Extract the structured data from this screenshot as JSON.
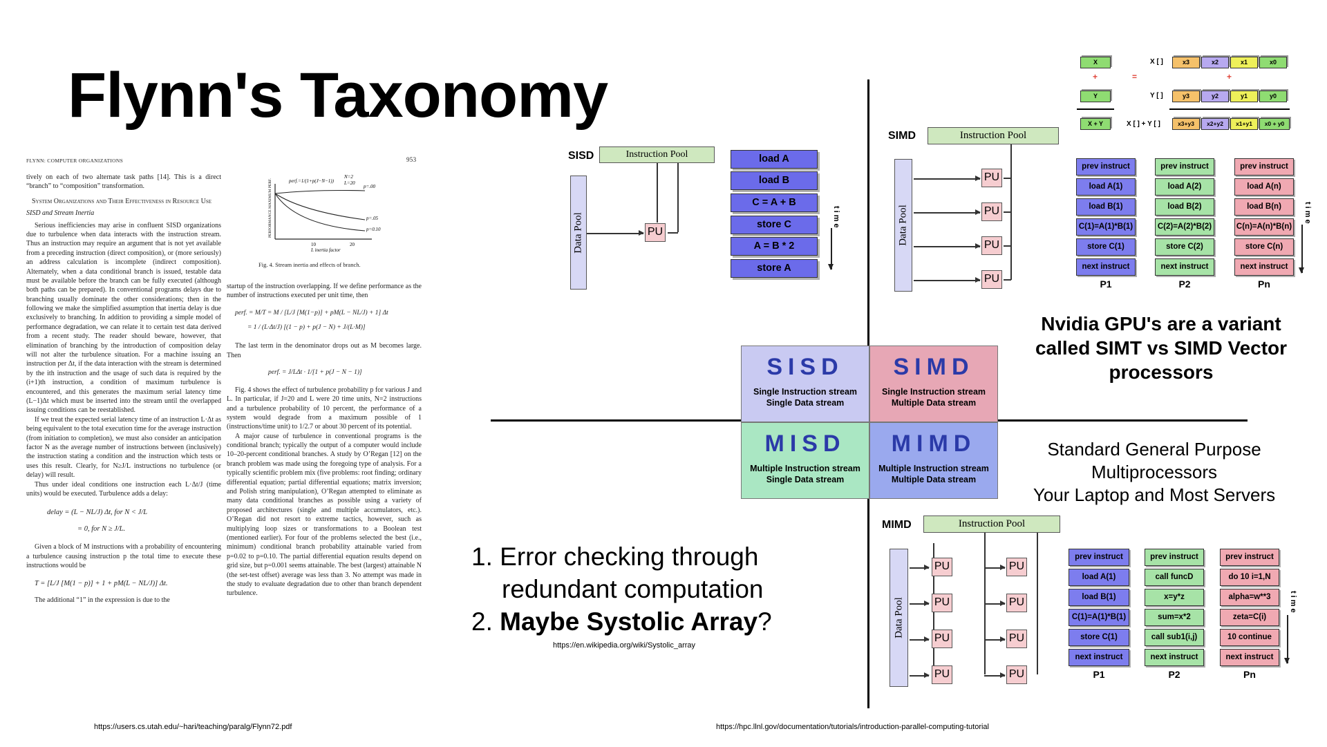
{
  "title": "Flynn's Taxonomy",
  "paper": {
    "header_left": "FLYNN: COMPUTER ORGANIZATIONS",
    "page_number": "953",
    "intro": "tively on each of two alternate task paths [14]. This is a direct “branch” to “composition” transformation.",
    "section_title": "System Organizations and Their Effectiveness in Resource Use",
    "subsection_title": "SISD and Stream Inertia",
    "para1": "Serious inefficiencies may arise in confluent SISD organizations due to turbulence when data interacts with the instruction stream. Thus an instruction may require an argument that is not yet available from a preceding instruction (direct composition), or (more seriously) an address calculation is incomplete (indirect composition). Alternately, when a data conditional branch is issued, testable data must be available before the branch can be fully executed (although both paths can be prepared). In conventional programs delays due to branching usually dominate the other considerations; then in the following we make the simplified assumption that inertia delay is due exclusively to branching. In addition to providing a simple model of performance degradation, we can relate it to certain test data derived from a recent study. The reader should beware, however, that elimination of branching by the introduction of composition delay will not alter the turbulence situation. For a machine issuing an instruction per Δt, if the data interaction with the stream is determined by the ith instruction and the usage of such data is required by the (i+1)th instruction, a condition of maximum turbulence is encountered, and this generates the maximum serial latency time (L−1)Δt which must be inserted into the stream until the overlapped issuing conditions can be reestablished.",
    "para2": "If we treat the expected serial latency time of an instruction L·Δt as being equivalent to the total execution time for the average instruction (from initiation to completion), we must also consider an anticipation factor N as the average number of instructions between (inclusively) the instruction stating a condition and the instruction which tests or uses this result. Clearly, for N≥J/L instructions no turbulence (or delay) will result.",
    "para3": "Thus under ideal conditions one instruction each L·Δt/J (time units) would be executed. Turbulence adds a delay:",
    "delay_formula_1": "delay = (L − NL/J) Δt,      for N < J/L",
    "delay_formula_2": "= 0,                        for N ≥ J/L.",
    "para4": "Given a block of M instructions with a probability of encountering a turbulence causing instruction p the total time to execute these instructions would be",
    "time_formula": "T = [L/J [M(1 − p)] + 1 + pM(L − NL/J)] Δt.",
    "para5": "The additional “1” in the expression is due to the",
    "fig_caption": "Fig. 4.   Stream inertia and effects of branch.",
    "fig_ylabel": "PERFORMANCE MAXIMUM PERF.",
    "fig_xlabel": "L inertia factor",
    "fig_curve_labels": [
      "p=.00",
      "p=.05",
      "p=0.10"
    ],
    "fig_params": [
      "N=2",
      "L=20"
    ],
    "fig_xticks": [
      "10",
      "20"
    ],
    "fig_topnote": "perf.=1/(1+p(J−N−1))",
    "col2_para1": "startup of the instruction overlapping. If we define performance as the number of instructions executed per unit time, then",
    "perf_formula_1": "perf. = M/T = M / [L/J [M(1−p)] + pM(L − NL/J) + 1] Δt",
    "perf_formula_2": "= 1 / (L·Δt/J) [(1 − p) + p(J − N) + J/(L·M)]",
    "col2_para2": "The last term in the denominator drops out as M becomes large. Then",
    "perf_formula_3": "perf. = J/LΔt · 1/[1 + p(J − N − 1)]",
    "col2_para3": "Fig. 4 shows the effect of turbulence probability p for various J and L. In particular, if J=20 and L were 20 time units, N=2 instructions and a turbulence probability of 10 percent, the performance of a system would degrade from a maximum possible of 1 (instructions/time unit) to 1/2.7 or about 30 percent of its potential.",
    "col2_para4": "A major cause of turbulence in conventional programs is the conditional branch; typically the output of a computer would include 10–20-percent conditional branches. A study by O’Regan [12] on the branch problem was made using the foregoing type of analysis. For a typically scientific problem mix (five problems: root finding; ordinary differential equation; partial differential equations; matrix inversion; and Polish string manipulation), O’Regan attempted to eliminate as many data conditional branches as possible using a variety of proposed architectures (single and multiple accumulators, etc.). O’Regan did not resort to extreme tactics, however, such as multiplying loop sizes or transformations to a Boolean test (mentioned earlier). For four of the problems selected the best (i.e., minimum) conditional branch probability attainable varied from p=0.02 to p=0.10. The partial differential equation results depend on grid size, but p=0.001 seems attainable. The best (largest) attainable N (the set-test offset) average was less than 3. No attempt was made in the study to evaluate degradation due to other than branch dependent turbulence."
  },
  "sisd": {
    "label": "SISD",
    "instruction_pool": "Instruction Pool",
    "data_pool": "Data Pool",
    "pu": "PU",
    "instructions": [
      "load A",
      "load B",
      "C = A + B",
      "store C",
      "A = B * 2",
      "store A"
    ],
    "time_label": "time"
  },
  "simd": {
    "label": "SIMD",
    "instruction_pool": "Instruction Pool",
    "data_pool": "Data Pool",
    "pu": [
      "PU",
      "PU",
      "PU",
      "PU"
    ],
    "time_label": "time",
    "columns": [
      {
        "label": "P1",
        "cells": [
          "prev instruct",
          "load A(1)",
          "load B(1)",
          "C(1)=A(1)*B(1)",
          "store C(1)",
          "next instruct"
        ]
      },
      {
        "label": "P2",
        "cells": [
          "prev instruct",
          "load A(2)",
          "load B(2)",
          "C(2)=A(2)*B(2)",
          "store C(2)",
          "next instruct"
        ]
      },
      {
        "label": "Pn",
        "cells": [
          "prev instruct",
          "load A(n)",
          "load B(n)",
          "C(n)=A(n)*B(n)",
          "store C(n)",
          "next instruct"
        ]
      }
    ]
  },
  "vector_add": {
    "row_x": {
      "short": "X",
      "label": "X [ ]",
      "cells": [
        "x3",
        "x2",
        "x1",
        "x0"
      ]
    },
    "row_y": {
      "short": "Y",
      "label": "Y [ ]",
      "cells": [
        "y3",
        "y2",
        "y1",
        "y0"
      ]
    },
    "row_sum": {
      "short": "X + Y",
      "label": "X [ ] + Y [ ]",
      "cells": [
        "x3+y3",
        "x2+y2",
        "x1+y1",
        "x0 + y0"
      ]
    },
    "plus": "+",
    "equals": "="
  },
  "quadrants": {
    "sisd": {
      "abbr": "SISD",
      "line1": "Single Instruction stream",
      "line2": "Single Data stream",
      "color": "#c9caf2"
    },
    "simd": {
      "abbr": "SIMD",
      "line1": "Single Instruction stream",
      "line2": "Multiple Data stream",
      "color": "#e7a7b5"
    },
    "misd": {
      "abbr": "MISD",
      "line1": "Multiple Instruction stream",
      "line2": "Single Data stream",
      "color": "#aae7c3"
    },
    "mimd": {
      "abbr": "MIMD",
      "line1": "Multiple Instruction stream",
      "line2": "Multiple Data stream",
      "color": "#9aa9ee"
    }
  },
  "nvidia_note": "Nvidia GPU's are a variant called SIMT vs SIMD Vector processors",
  "mimd_note": {
    "line1": "Standard General Purpose",
    "line2": "Multiprocessors",
    "line3": "Your Laptop and Most Servers"
  },
  "misd_list": {
    "item1_num": "1.",
    "item1_line1": "Error checking through",
    "item1_line2": "redundant computation",
    "item2_num": "2.",
    "item2_bold": "Maybe Systolic Array",
    "item2_suffix": "?",
    "url": "https://en.wikipedia.org/wiki/Systolic_array"
  },
  "mimd": {
    "label": "MIMD",
    "instruction_pool": "Instruction Pool",
    "data_pool": "Data Pool",
    "pu": "PU",
    "time_label": "time",
    "columns": [
      {
        "label": "P1",
        "cells": [
          "prev instruct",
          "load A(1)",
          "load B(1)",
          "C(1)=A(1)*B(1)",
          "store C(1)",
          "next instruct"
        ]
      },
      {
        "label": "P2",
        "cells": [
          "prev instruct",
          "call funcD",
          "x=y*z",
          "sum=x*2",
          "call sub1(i,j)",
          "next instruct"
        ]
      },
      {
        "label": "Pn",
        "cells": [
          "prev instruct",
          "do 10 i=1,N",
          "alpha=w**3",
          "zeta=C(i)",
          "10 continue",
          "next instruct"
        ]
      }
    ]
  },
  "footer": {
    "left_url": "https://users.cs.utah.edu/~hari/teaching/paralg/Flynn72.pdf",
    "right_url": "https://hpc.llnl.gov/documentation/tutorials/introduction-parallel-computing-tutorial"
  }
}
